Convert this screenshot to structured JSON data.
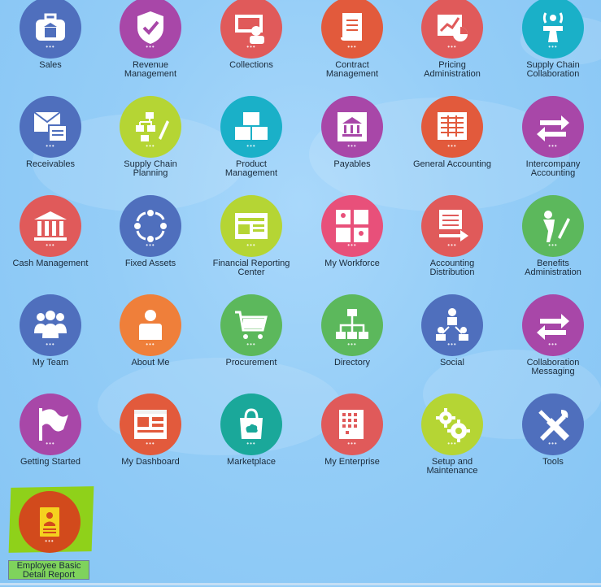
{
  "tiles": [
    {
      "label": "Sales",
      "color": "#4f6fbd",
      "icon": "briefcase-bank-icon"
    },
    {
      "label": "Revenue\nManagement",
      "color": "#a847a8",
      "icon": "shield-check-icon"
    },
    {
      "label": "Collections",
      "color": "#e05a5a",
      "icon": "money-people-icon"
    },
    {
      "label": "Contract\nManagement",
      "color": "#e25a3c",
      "icon": "scroll-icon"
    },
    {
      "label": "Pricing\nAdministration",
      "color": "#e05a5a",
      "icon": "chart-money-icon"
    },
    {
      "label": "Supply Chain\nCollaboration",
      "color": "#1ab0c8",
      "icon": "broadcast-tower-icon"
    },
    {
      "label": "Receivables",
      "color": "#4f6fbd",
      "icon": "envelope-invoice-icon"
    },
    {
      "label": "Supply Chain\nPlanning",
      "color": "#b5d534",
      "icon": "hierarchy-pencil-icon"
    },
    {
      "label": "Product\nManagement",
      "color": "#1ab0c8",
      "icon": "boxes-icon"
    },
    {
      "label": "Payables",
      "color": "#a847a8",
      "icon": "bank-building-icon"
    },
    {
      "label": "General Accounting",
      "color": "#e25a3c",
      "icon": "ledger-grid-icon"
    },
    {
      "label": "Intercompany\nAccounting",
      "color": "#a847a8",
      "icon": "exchange-arrows-icon"
    },
    {
      "label": "Cash Management",
      "color": "#e05a5a",
      "icon": "bank-columns-icon"
    },
    {
      "label": "Fixed Assets",
      "color": "#4f6fbd",
      "icon": "cycle-arrows-icon"
    },
    {
      "label": "Financial Reporting\nCenter",
      "color": "#b5d534",
      "icon": "report-window-icon"
    },
    {
      "label": "My Workforce",
      "color": "#e8507a",
      "icon": "people-grid-icon"
    },
    {
      "label": "Accounting\nDistribution",
      "color": "#e05a5a",
      "icon": "ledger-arrow-icon"
    },
    {
      "label": "Benefits\nAdministration",
      "color": "#5cb85c",
      "icon": "person-pencil-icon"
    },
    {
      "label": "My Team",
      "color": "#4f6fbd",
      "icon": "team-people-icon"
    },
    {
      "label": "About Me",
      "color": "#ef7f3a",
      "icon": "person-badge-icon"
    },
    {
      "label": "Procurement",
      "color": "#5cb85c",
      "icon": "shopping-cart-icon"
    },
    {
      "label": "Directory",
      "color": "#5cb85c",
      "icon": "org-chart-icon"
    },
    {
      "label": "Social",
      "color": "#4f6fbd",
      "icon": "social-network-icon"
    },
    {
      "label": "Collaboration\nMessaging",
      "color": "#a847a8",
      "icon": "exchange-arrows-icon"
    },
    {
      "label": "Getting Started",
      "color": "#a847a8",
      "icon": "flag-icon"
    },
    {
      "label": "My Dashboard",
      "color": "#e25a3c",
      "icon": "dashboard-window-icon"
    },
    {
      "label": "Marketplace",
      "color": "#1aa89a",
      "icon": "shopping-bag-cloud-icon"
    },
    {
      "label": "My Enterprise",
      "color": "#e05a5a",
      "icon": "office-building-icon"
    },
    {
      "label": "Setup and\nMaintenance",
      "color": "#b5d534",
      "icon": "gears-icon"
    },
    {
      "label": "Tools",
      "color": "#4f6fbd",
      "icon": "wrench-hammer-icon"
    }
  ],
  "highlighted_tile": {
    "label": "Employee Basic\nDetail Report",
    "color": "#d24a1c",
    "icon_color": "#f5d21f",
    "icon": "id-card-icon"
  }
}
